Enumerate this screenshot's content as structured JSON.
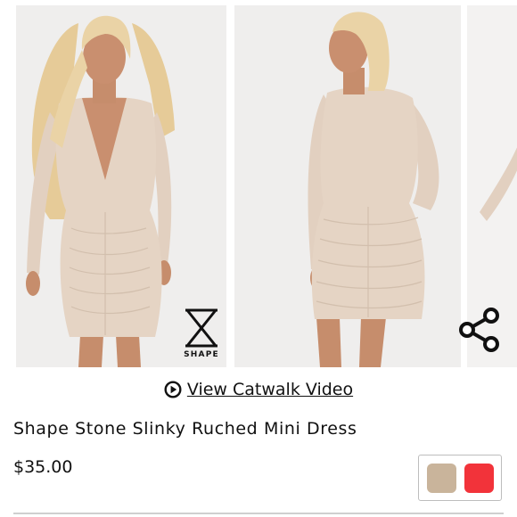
{
  "gallery": {
    "images": [
      {
        "name": "front-view",
        "brand_logo": "SHAPE"
      },
      {
        "name": "back-view"
      },
      {
        "name": "side-view-partial"
      }
    ],
    "brand_logo_text": "SHAPE",
    "share_icon": "share-icon"
  },
  "video_link": {
    "icon": "play-circle-icon",
    "label": "View Catwalk Video"
  },
  "product": {
    "title": "Shape Stone Slinky Ruched Mini Dress",
    "price": "$35.00"
  },
  "swatches": [
    {
      "name": "stone",
      "color": "#c9b49b"
    },
    {
      "name": "red",
      "color": "#f2333a"
    }
  ],
  "colors": {
    "photo_background": "#eeedec",
    "dress": "#e5d4c4",
    "skin": "#c98f6f",
    "hair": "#e8cfa0",
    "text": "#111111"
  }
}
